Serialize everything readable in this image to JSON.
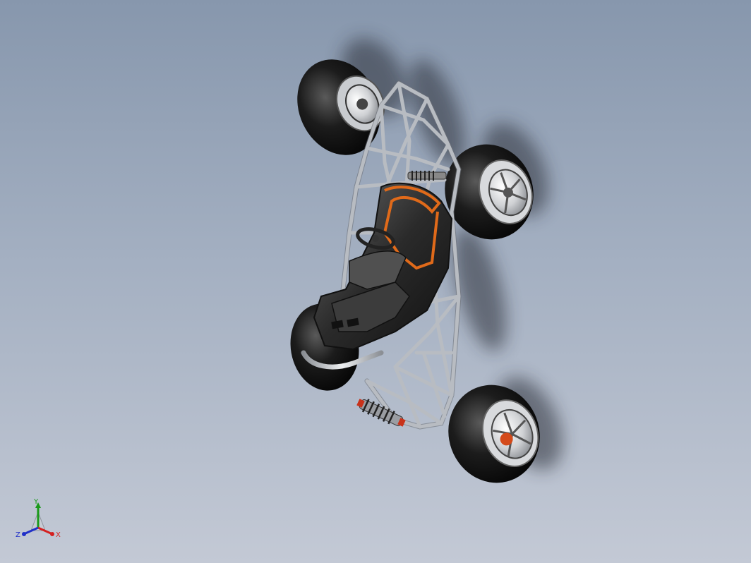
{
  "viewport": {
    "background_top": "#8797ad",
    "background_bottom": "#c3c9d5"
  },
  "model": {
    "parts": [
      "chassis-frame",
      "seat",
      "steering-wheel",
      "front-left-wheel",
      "front-right-wheel",
      "rear-left-wheel",
      "rear-right-wheel",
      "rear-shock-absorber",
      "front-shock-absorber"
    ],
    "accent_color": "#e06a1a",
    "tire_color": "#111111",
    "frame_color": "#b8bcc2"
  },
  "triad": {
    "x_label": "X",
    "y_label": "Y",
    "z_label": "Z",
    "x_color": "#d42020",
    "y_color": "#1a9a1a",
    "z_color": "#2030c8"
  }
}
